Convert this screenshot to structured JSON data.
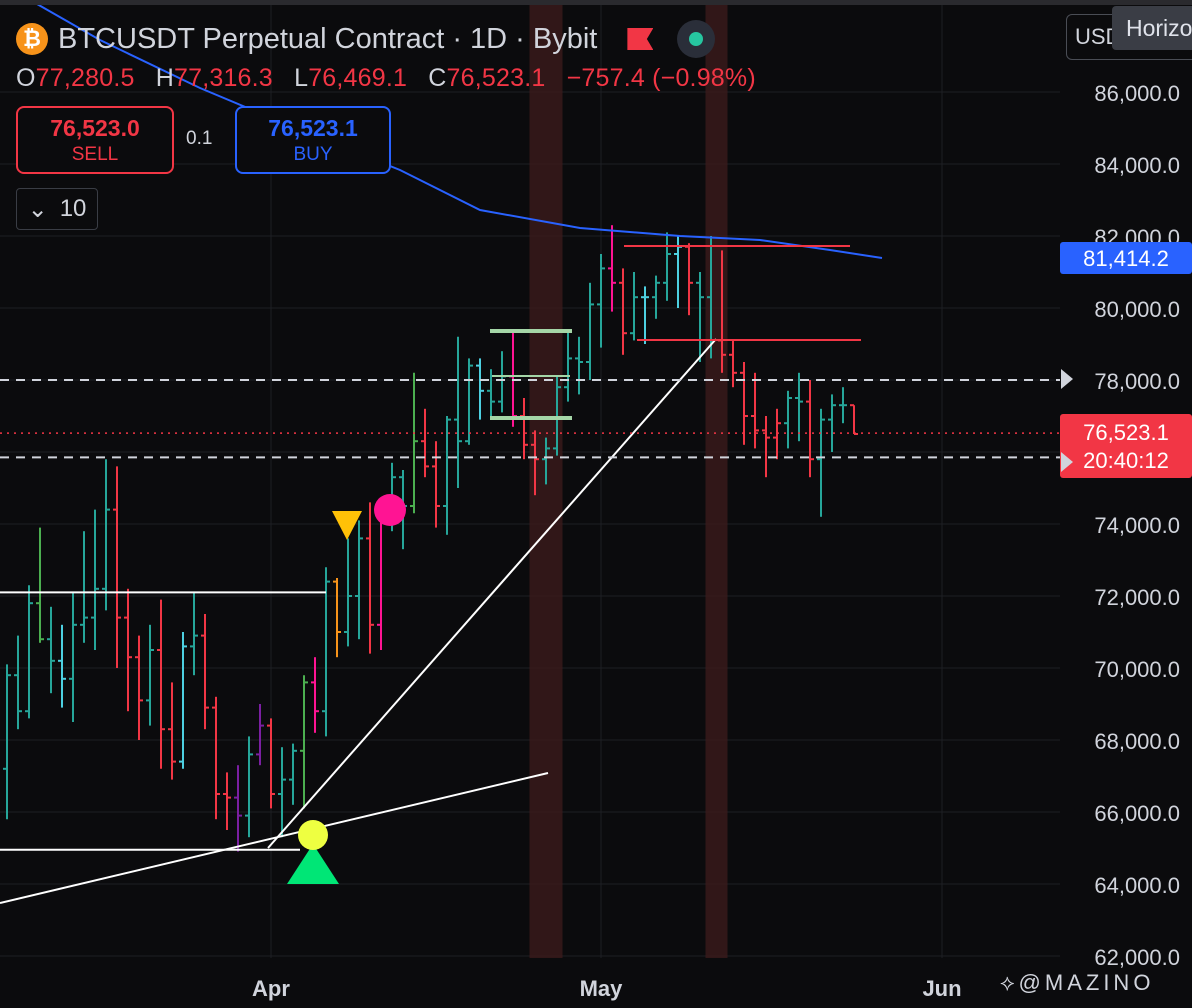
{
  "header": {
    "title": "BTCUSDT Perpetual Contract · 1D · Bybit",
    "coin_symbol": "₿",
    "ohlc": {
      "o_label": "O",
      "o": "77,280.5",
      "h_label": "H",
      "h": "77,316.3",
      "l_label": "L",
      "l": "76,469.1",
      "c_label": "C",
      "c": "76,523.1",
      "change": "−757.4 (−0.98%)"
    }
  },
  "trade": {
    "sell_price": "76,523.0",
    "sell_label": "SELL",
    "buy_price": "76,523.1",
    "buy_label": "BUY",
    "quantity": "0.1"
  },
  "interval": {
    "chevron": "⌄",
    "value": "10"
  },
  "currency_button": "USD",
  "tooltip": "Horizontal",
  "watermark": "⟡@MAZINO",
  "colors": {
    "up": "#26a69a",
    "down": "#f23645",
    "ma": "#2962ff",
    "orange": "#f7931a",
    "pink": "#ff1493",
    "purple": "#7b1fa2",
    "yellow": "#ffc107",
    "mint": "#00e676",
    "lime": "#eeff41",
    "cyan": "#4dd0e1",
    "green": "#4caf50"
  },
  "chart_data": {
    "type": "ohlc",
    "price_axis": {
      "min": 62000,
      "max": 86000,
      "ticks": [
        "86,000.0",
        "84,000.0",
        "82,000.0",
        "80,000.0",
        "78,000.0",
        "76,000.0",
        "74,000.0",
        "72,000.0",
        "70,000.0",
        "68,000.0",
        "66,000.0",
        "64,000.0",
        "62,000.0"
      ],
      "tick_values": [
        86000,
        84000,
        82000,
        80000,
        78000,
        76000,
        74000,
        72000,
        70000,
        68000,
        66000,
        64000,
        62000
      ]
    },
    "time_axis": {
      "labels": [
        {
          "text": "Apr",
          "day": 31
        },
        {
          "text": "May",
          "day": 61
        },
        {
          "text": "Jun",
          "day": 92
        }
      ]
    },
    "price_labels": {
      "ma_value": "81,414.2",
      "last_price": "76,523.1",
      "countdown": "20:40:12"
    },
    "bars": [
      {
        "d": 7,
        "o": 67200,
        "h": 70100,
        "l": 65800,
        "c": 69800,
        "col": "up"
      },
      {
        "d": 8,
        "o": 69800,
        "h": 70900,
        "l": 68300,
        "c": 68800,
        "col": "up"
      },
      {
        "d": 9,
        "o": 68800,
        "h": 72300,
        "l": 68600,
        "c": 71800,
        "col": "up"
      },
      {
        "d": 10,
        "o": 71800,
        "h": 73900,
        "l": 70700,
        "c": 70800,
        "col": "green"
      },
      {
        "d": 11,
        "o": 70800,
        "h": 71700,
        "l": 69300,
        "c": 70200,
        "col": "up"
      },
      {
        "d": 12,
        "o": 70200,
        "h": 71200,
        "l": 68900,
        "c": 69700,
        "col": "cyan"
      },
      {
        "d": 13,
        "o": 69700,
        "h": 72100,
        "l": 68500,
        "c": 71200,
        "col": "up"
      },
      {
        "d": 14,
        "o": 71200,
        "h": 73800,
        "l": 70700,
        "c": 71400,
        "col": "up"
      },
      {
        "d": 15,
        "o": 71400,
        "h": 74400,
        "l": 70500,
        "c": 72200,
        "col": "up"
      },
      {
        "d": 16,
        "o": 72200,
        "h": 75800,
        "l": 71600,
        "c": 74400,
        "col": "up"
      },
      {
        "d": 17,
        "o": 74400,
        "h": 75600,
        "l": 70000,
        "c": 71400,
        "col": "down"
      },
      {
        "d": 18,
        "o": 71400,
        "h": 72200,
        "l": 68800,
        "c": 70300,
        "col": "down"
      },
      {
        "d": 19,
        "o": 70300,
        "h": 70900,
        "l": 68000,
        "c": 69100,
        "col": "down"
      },
      {
        "d": 20,
        "o": 69100,
        "h": 71200,
        "l": 68400,
        "c": 70500,
        "col": "up"
      },
      {
        "d": 21,
        "o": 70500,
        "h": 71900,
        "l": 67200,
        "c": 68300,
        "col": "down"
      },
      {
        "d": 22,
        "o": 68300,
        "h": 69600,
        "l": 66900,
        "c": 67400,
        "col": "down"
      },
      {
        "d": 23,
        "o": 67400,
        "h": 71000,
        "l": 67200,
        "c": 70600,
        "col": "cyan"
      },
      {
        "d": 24,
        "o": 70600,
        "h": 72100,
        "l": 69800,
        "c": 70900,
        "col": "up"
      },
      {
        "d": 25,
        "o": 70900,
        "h": 71500,
        "l": 68300,
        "c": 68900,
        "col": "down"
      },
      {
        "d": 26,
        "o": 68900,
        "h": 69200,
        "l": 65800,
        "c": 66500,
        "col": "down"
      },
      {
        "d": 27,
        "o": 66500,
        "h": 67100,
        "l": 65500,
        "c": 66400,
        "col": "down"
      },
      {
        "d": 28,
        "o": 66400,
        "h": 67300,
        "l": 64900,
        "c": 65900,
        "col": "purple"
      },
      {
        "d": 29,
        "o": 65900,
        "h": 68100,
        "l": 65300,
        "c": 67600,
        "col": "up"
      },
      {
        "d": 30,
        "o": 67600,
        "h": 69000,
        "l": 67300,
        "c": 68400,
        "col": "purple"
      },
      {
        "d": 31,
        "o": 68400,
        "h": 68600,
        "l": 66100,
        "c": 66500,
        "col": "down"
      },
      {
        "d": 32,
        "o": 66500,
        "h": 67800,
        "l": 65300,
        "c": 66900,
        "col": "up"
      },
      {
        "d": 33,
        "o": 66900,
        "h": 67900,
        "l": 66200,
        "c": 67700,
        "col": "up"
      },
      {
        "d": 34,
        "o": 67700,
        "h": 69800,
        "l": 66100,
        "c": 69600,
        "col": "green"
      },
      {
        "d": 35,
        "o": 69600,
        "h": 70300,
        "l": 68200,
        "c": 68800,
        "col": "pink"
      },
      {
        "d": 36,
        "o": 68800,
        "h": 72800,
        "l": 68100,
        "c": 72400,
        "col": "up"
      },
      {
        "d": 37,
        "o": 72400,
        "h": 72500,
        "l": 70300,
        "c": 71000,
        "col": "orange"
      },
      {
        "d": 38,
        "o": 71000,
        "h": 73600,
        "l": 70600,
        "c": 72000,
        "col": "up"
      },
      {
        "d": 39,
        "o": 72000,
        "h": 74100,
        "l": 70800,
        "c": 73600,
        "col": "up"
      },
      {
        "d": 40,
        "o": 73600,
        "h": 74600,
        "l": 70400,
        "c": 71200,
        "col": "down"
      },
      {
        "d": 41,
        "o": 71200,
        "h": 74300,
        "l": 70500,
        "c": 74100,
        "col": "pink"
      },
      {
        "d": 42,
        "o": 74100,
        "h": 75700,
        "l": 73800,
        "c": 75300,
        "col": "up"
      },
      {
        "d": 43,
        "o": 75300,
        "h": 75500,
        "l": 73300,
        "c": 74500,
        "col": "up"
      },
      {
        "d": 44,
        "o": 74500,
        "h": 78200,
        "l": 74300,
        "c": 76300,
        "col": "green"
      },
      {
        "d": 45,
        "o": 76300,
        "h": 77200,
        "l": 75300,
        "c": 75600,
        "col": "down"
      },
      {
        "d": 46,
        "o": 75600,
        "h": 76300,
        "l": 73900,
        "c": 74500,
        "col": "down"
      },
      {
        "d": 47,
        "o": 74500,
        "h": 77000,
        "l": 73700,
        "c": 76900,
        "col": "up"
      },
      {
        "d": 48,
        "o": 76900,
        "h": 79200,
        "l": 75000,
        "c": 76300,
        "col": "up"
      },
      {
        "d": 49,
        "o": 76300,
        "h": 78600,
        "l": 76200,
        "c": 78400,
        "col": "up"
      },
      {
        "d": 50,
        "o": 78400,
        "h": 78600,
        "l": 76900,
        "c": 77700,
        "col": "cyan"
      },
      {
        "d": 51,
        "o": 77700,
        "h": 78300,
        "l": 77000,
        "c": 77400,
        "col": "up"
      },
      {
        "d": 52,
        "o": 77400,
        "h": 78800,
        "l": 77100,
        "c": 78100,
        "col": "up"
      },
      {
        "d": 53,
        "o": 78100,
        "h": 79400,
        "l": 76700,
        "c": 77000,
        "col": "pink"
      },
      {
        "d": 54,
        "o": 77000,
        "h": 77500,
        "l": 75800,
        "c": 76200,
        "col": "down"
      },
      {
        "d": 55,
        "o": 76200,
        "h": 76600,
        "l": 74800,
        "c": 75800,
        "col": "down"
      },
      {
        "d": 56,
        "o": 75800,
        "h": 76400,
        "l": 75100,
        "c": 76100,
        "col": "up"
      },
      {
        "d": 57,
        "o": 76100,
        "h": 78100,
        "l": 75900,
        "c": 77800,
        "col": "up"
      },
      {
        "d": 58,
        "o": 77800,
        "h": 79400,
        "l": 77400,
        "c": 78600,
        "col": "up"
      },
      {
        "d": 59,
        "o": 78600,
        "h": 79200,
        "l": 77600,
        "c": 78500,
        "col": "up"
      },
      {
        "d": 60,
        "o": 78500,
        "h": 80700,
        "l": 78000,
        "c": 80100,
        "col": "up"
      },
      {
        "d": 61,
        "o": 80100,
        "h": 81500,
        "l": 78900,
        "c": 81100,
        "col": "up"
      },
      {
        "d": 62,
        "o": 81100,
        "h": 82300,
        "l": 79900,
        "c": 80700,
        "col": "pink"
      },
      {
        "d": 63,
        "o": 80700,
        "h": 81100,
        "l": 78700,
        "c": 79300,
        "col": "down"
      },
      {
        "d": 64,
        "o": 79300,
        "h": 81000,
        "l": 79100,
        "c": 80300,
        "col": "up"
      },
      {
        "d": 65,
        "o": 80300,
        "h": 80600,
        "l": 79000,
        "c": 80300,
        "col": "cyan"
      },
      {
        "d": 66,
        "o": 80300,
        "h": 80900,
        "l": 79700,
        "c": 80700,
        "col": "up"
      },
      {
        "d": 67,
        "o": 80700,
        "h": 82100,
        "l": 80200,
        "c": 81500,
        "col": "up"
      },
      {
        "d": 68,
        "o": 81500,
        "h": 82000,
        "l": 80000,
        "c": 81700,
        "col": "cyan"
      },
      {
        "d": 69,
        "o": 81700,
        "h": 81800,
        "l": 79800,
        "c": 80700,
        "col": "down"
      },
      {
        "d": 70,
        "o": 80700,
        "h": 81000,
        "l": 78500,
        "c": 80300,
        "col": "up"
      },
      {
        "d": 71,
        "o": 80300,
        "h": 82000,
        "l": 78600,
        "c": 79100,
        "col": "up"
      },
      {
        "d": 72,
        "o": 79100,
        "h": 81600,
        "l": 78200,
        "c": 78700,
        "col": "down"
      },
      {
        "d": 73,
        "o": 78700,
        "h": 79100,
        "l": 77800,
        "c": 78200,
        "col": "down"
      },
      {
        "d": 74,
        "o": 78200,
        "h": 78500,
        "l": 76200,
        "c": 77000,
        "col": "down"
      },
      {
        "d": 75,
        "o": 77000,
        "h": 78200,
        "l": 76100,
        "c": 76600,
        "col": "down"
      },
      {
        "d": 76,
        "o": 76600,
        "h": 77000,
        "l": 75300,
        "c": 76400,
        "col": "down"
      },
      {
        "d": 77,
        "o": 76400,
        "h": 77200,
        "l": 75800,
        "c": 76800,
        "col": "down"
      },
      {
        "d": 78,
        "o": 76800,
        "h": 77700,
        "l": 76100,
        "c": 77500,
        "col": "up"
      },
      {
        "d": 79,
        "o": 77500,
        "h": 78200,
        "l": 76300,
        "c": 77400,
        "col": "up"
      },
      {
        "d": 80,
        "o": 77400,
        "h": 78000,
        "l": 75300,
        "c": 75800,
        "col": "down"
      },
      {
        "d": 81,
        "o": 75800,
        "h": 77200,
        "l": 74200,
        "c": 76900,
        "col": "up"
      },
      {
        "d": 82,
        "o": 76900,
        "h": 77600,
        "l": 76000,
        "c": 77300,
        "col": "up"
      },
      {
        "d": 83,
        "o": 77300,
        "h": 77800,
        "l": 76800,
        "c": 77300,
        "col": "up"
      },
      {
        "d": 84,
        "o": 77300,
        "h": 77300,
        "l": 76500,
        "c": 76500,
        "col": "down"
      }
    ]
  }
}
